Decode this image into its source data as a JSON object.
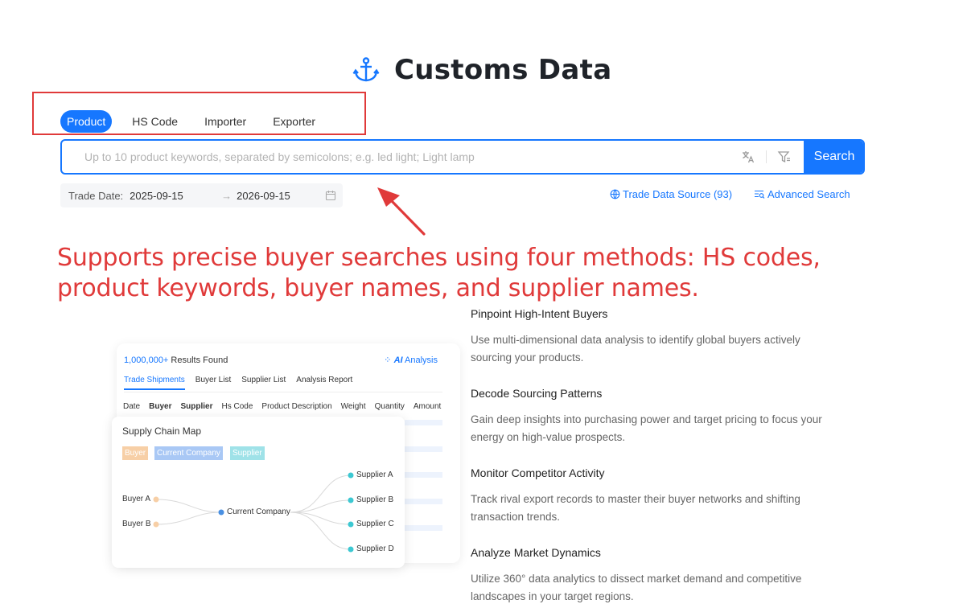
{
  "header": {
    "title": "Customs Data",
    "icon": "anchor-icon"
  },
  "tabs": [
    {
      "label": "Product",
      "active": true
    },
    {
      "label": "HS Code",
      "active": false
    },
    {
      "label": "Importer",
      "active": false
    },
    {
      "label": "Exporter",
      "active": false
    }
  ],
  "search": {
    "value": "",
    "placeholder": "Up to 10 product keywords, separated by semicolons; e.g. led light; Light lamp",
    "button_label": "Search",
    "tool_icons": [
      "translate-icon",
      "filter-icon"
    ]
  },
  "trade_date": {
    "label": "Trade Date:",
    "start": "2025-09-15",
    "end": "2026-09-15",
    "separator": "→"
  },
  "links": {
    "source": "Trade Data Source (93)",
    "advanced": "Advanced Search"
  },
  "annotation": {
    "text": "Supports precise buyer searches using four methods: HS codes, product keywords, buyer names, and supplier names.",
    "color": "#e03a3a"
  },
  "illustration": {
    "results_count": "1,000,000+",
    "results_label": " Results Found",
    "ai_label": "AI",
    "analysis_label": " Analysis",
    "tabs": [
      "Trade Shipments",
      "Buyer List",
      "Supplier List",
      "Analysis Report"
    ],
    "columns": [
      "Date",
      "Buyer",
      "Supplier",
      "Hs Code",
      "Product Description",
      "Weight",
      "Quantity",
      "Amount"
    ],
    "map_title": "Supply Chain Map",
    "chips": [
      "Buyer",
      "Current Company",
      "Supplier"
    ],
    "buyers": [
      "Buyer A",
      "Buyer B"
    ],
    "center": "Current Company",
    "suppliers": [
      "Supplier A",
      "Supplier B",
      "Supplier C",
      "Supplier D"
    ]
  },
  "features": [
    {
      "title": "Pinpoint High-Intent Buyers",
      "desc": "Use multi-dimensional data analysis to identify global buyers actively sourcing your products."
    },
    {
      "title": "Decode Sourcing Patterns",
      "desc": "Gain deep insights into purchasing power and target pricing to focus your energy on high-value prospects."
    },
    {
      "title": "Monitor Competitor Activity",
      "desc": "Track rival export records to master their buyer networks and shifting transaction trends."
    },
    {
      "title": "Analyze Market Dynamics",
      "desc": "Utilize 360° data analytics to dissect market demand and competitive landscapes in your target regions."
    }
  ],
  "colors": {
    "primary": "#1677ff",
    "annotation": "#e03a3a",
    "buyer": "#f7cfa6",
    "current": "#a9c8f5",
    "supplier": "#9fe2e8"
  }
}
